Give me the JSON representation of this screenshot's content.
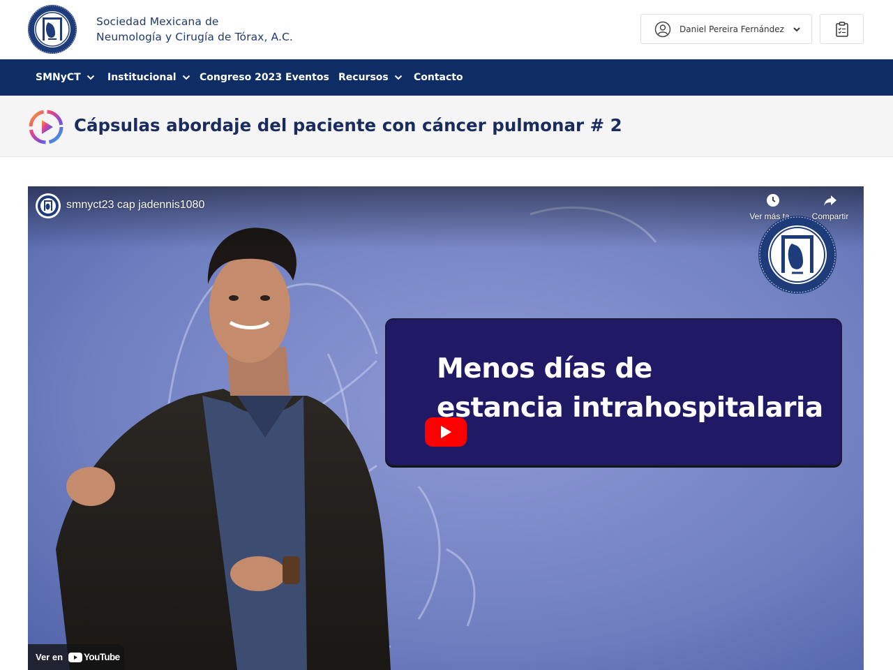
{
  "header": {
    "org_name_line1": "Sociedad Mexicana de",
    "org_name_line2": "Neumología y Cirugía de Tórax, A.C.",
    "user_name": "Daniel Pereira Fernández",
    "icons": [
      "society-seal-logo",
      "user-circle-icon",
      "chevron-down-icon",
      "clipboard-checklist-icon"
    ]
  },
  "nav": {
    "items": [
      {
        "label": "SMNyCT",
        "has_dropdown": true
      },
      {
        "label": "Institucional",
        "has_dropdown": true
      },
      {
        "label": "Congreso 2023",
        "has_dropdown": false
      },
      {
        "label": "Eventos",
        "has_dropdown": false
      },
      {
        "label": "Recursos",
        "has_dropdown": true
      },
      {
        "label": "Contacto",
        "has_dropdown": false
      }
    ]
  },
  "page": {
    "title": "Cápsulas abordaje del paciente con cáncer pulmonar # 2",
    "title_icon": "play-ring-icon"
  },
  "video": {
    "channel_title": "smnyct23 cap jadennis1080",
    "watch_later_label": "Ver más ta...",
    "share_label": "Compartir",
    "card_line1": "Menos días de",
    "card_line2": "estancia intrahospitalaria",
    "watch_on_label": "Ver en",
    "youtube_label": "YouTube"
  },
  "colors": {
    "nav_bg": "#0d2d64",
    "title_text": "#1a2c5e",
    "org_text": "#1e3a6e",
    "card_bg": "#201a66",
    "play_red": "#ff0000"
  }
}
